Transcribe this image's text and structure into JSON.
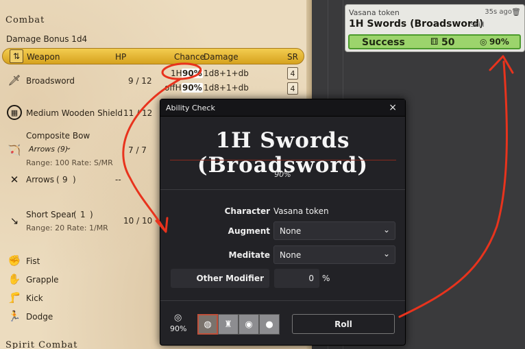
{
  "sheet": {
    "combat_title": "Combat",
    "damage_bonus": "Damage Bonus 1d4",
    "header": {
      "weapon": "Weapon",
      "hp": "HP",
      "chance": "Chance",
      "damage": "Damage",
      "sr": "SR"
    },
    "weapons": [
      {
        "name": "Broadsword",
        "hp": "9 / 12",
        "chance1_label": "1H",
        "chance1": "90%",
        "damage1": "1d8+1+db",
        "sr1": "4",
        "chance2_label": "offH",
        "chance2": "90%",
        "damage2": "1d8+1+db",
        "sr2": "4"
      },
      {
        "name": "Medium Wooden Shield",
        "hp": "11 / 12"
      },
      {
        "name": "Composite Bow",
        "ammo": "Arrows (9)",
        "range": "Range: 100 Rate: S/MR",
        "hp": "7 / 7"
      },
      {
        "name": "Arrows",
        "count": "9",
        "hp": "--"
      },
      {
        "name": "Short Spear",
        "count": "1",
        "range": "Range: 20 Rate: 1/MR",
        "hp": "10 / 10"
      }
    ],
    "unarmed": [
      "Fist",
      "Grapple",
      "Kick",
      "Dodge"
    ],
    "spirit_title": "Spirit Combat"
  },
  "chat": {
    "speaker": "Vasana token",
    "time": "35s ago",
    "title": "1H Swords (Broadsword)",
    "type": "Skill",
    "result": "Success",
    "roll": "50",
    "target": "90%"
  },
  "dialog": {
    "header": "Ability Check",
    "close": "×",
    "title": "1H Swords (Broadsword)",
    "chance": "90%",
    "character_label": "Character",
    "character_value": "Vasana token",
    "augment_label": "Augment",
    "augment_value": "None",
    "meditate_label": "Meditate",
    "meditate_value": "None",
    "modifier_label": "Other Modifier",
    "modifier_value": "0",
    "modifier_unit": "%",
    "footer_chance": "90%",
    "roll_button": "Roll"
  },
  "colors": {
    "accent": "#e8331d",
    "header_gold": "#e2b433",
    "success_green": "#9cd46c"
  }
}
